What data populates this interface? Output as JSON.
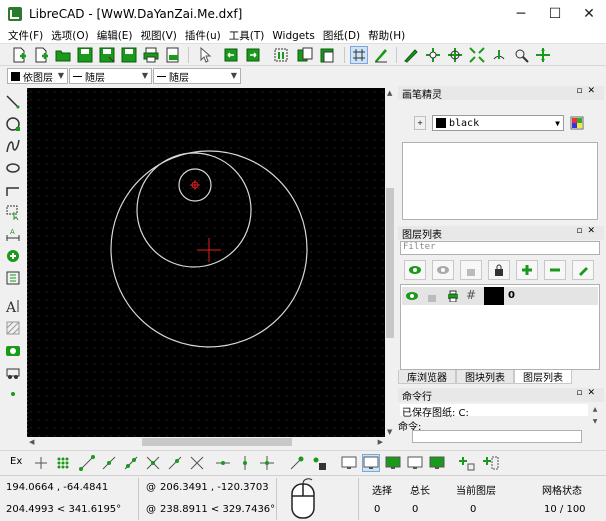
{
  "window": {
    "title": "LibreCAD - [WwW.DaYanZai.Me.dxf]",
    "minimize": "─",
    "maximize": "☐",
    "close": "✕"
  },
  "menu": [
    "文件(F)",
    "选项(O)",
    "编辑(E)",
    "视图(V)",
    "插件(u)",
    "工具(T)",
    "Widgets",
    "图纸(D)",
    "帮助(H)"
  ],
  "toolbar2": {
    "layer": "依图层",
    "line_type": "随层",
    "line_width": "随层"
  },
  "pen_panel": {
    "title": "画笔精灵",
    "color_value": "black"
  },
  "layer_panel": {
    "title": "图层列表",
    "filter_placeholder": "Filter",
    "layers": [
      {
        "name": "0"
      }
    ],
    "tabs": [
      "库浏览器",
      "图块列表",
      "图层列表"
    ],
    "active_tab": "图层列表"
  },
  "command_panel": {
    "title": "命令行",
    "history": "已保存图纸: C:",
    "prompt_label": "命令:"
  },
  "snapbar": {
    "ex_label": "Ex"
  },
  "status": {
    "abs_coord": "194.0664 , -64.4841",
    "polar_coord": "204.4993 < 341.6195°",
    "rel_prefix": "@",
    "rel_coord": "206.3491 , -120.3703",
    "rel_polar": "238.8911 < 329.7436°",
    "selection_label": "选择",
    "selection_value": "0",
    "length_label": "总长",
    "length_value": "0",
    "current_layer_label": "当前图层",
    "current_layer_value": "0",
    "grid_label": "网格状态",
    "grid_value": "10 / 100"
  }
}
